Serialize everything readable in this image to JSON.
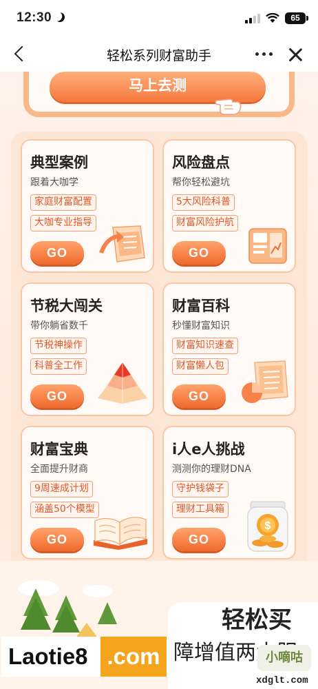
{
  "status_bar": {
    "time": "12:30",
    "battery": "65",
    "icons": [
      "moon-icon",
      "signal-icon",
      "wifi-icon",
      "battery-icon"
    ]
  },
  "nav": {
    "title": "轻松系列财富助手",
    "icons": [
      "back-icon",
      "more-icon",
      "close-icon"
    ]
  },
  "hero": {
    "cta_label": "马上去测"
  },
  "cards": [
    {
      "title": "典型案例",
      "subtitle": "跟着大咖学",
      "tags": [
        "家庭财富配置",
        "大咖专业指导"
      ],
      "go": "GO"
    },
    {
      "title": "风险盘点",
      "subtitle": "帮你轻松避坑",
      "tags": [
        "5大风险科普",
        "财富风险护航"
      ],
      "go": "GO"
    },
    {
      "title": "节税大闯关",
      "subtitle": "带你躺省数千",
      "tags": [
        "节税神操作",
        "科普全工作"
      ],
      "go": "GO"
    },
    {
      "title": "财富百科",
      "subtitle": "秒懂财富知识",
      "tags": [
        "财富知识速查",
        "财富懒人包"
      ],
      "go": "GO"
    },
    {
      "title": "财富宝典",
      "subtitle": "全面提升财商",
      "tags": [
        "9周速成计划",
        "涵盖50个模型"
      ],
      "go": "GO"
    },
    {
      "title": "i人e人挑战",
      "subtitle": "测测你的理财DNA",
      "tags": [
        "守护钱袋子",
        "理财工具箱"
      ],
      "go": "GO"
    }
  ],
  "bottom_banner": {
    "title": "轻松买",
    "subtitle": "障增值两大服"
  },
  "watermark": {
    "left_text": "Laotie8",
    "badge": ".com",
    "logo": "小嘀咕",
    "site": "xdglt.com"
  },
  "colors": {
    "accent": "#f06a2e",
    "tag_text": "#e2582a",
    "tag_border": "#f3a07a",
    "card_border": "#f7c7a6",
    "page_bg": "#fdeee3"
  }
}
